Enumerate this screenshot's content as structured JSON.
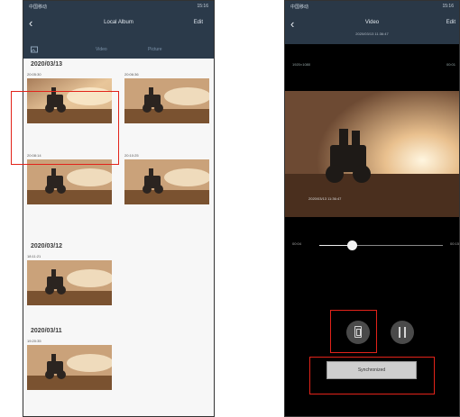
{
  "left_phone": {
    "status_left": "中国移动",
    "status_right": "15:16",
    "nav": {
      "back_icon": "chevron-left-icon",
      "title": "Local Album",
      "edit": "Edit"
    },
    "tabs": {
      "video": "Video",
      "photo": "Picture"
    },
    "groups": [
      {
        "date": "2020/03/13",
        "items": [
          {
            "time": "20:05:30"
          },
          {
            "time": "20:06:36"
          },
          {
            "time": "20:08:14"
          },
          {
            "time": "20:10:25"
          }
        ]
      },
      {
        "date": "2020/03/12",
        "items": [
          {
            "time": "18:11:21"
          }
        ]
      },
      {
        "date": "2020/03/11",
        "items": [
          {
            "time": "19:20:35"
          }
        ]
      }
    ]
  },
  "right_phone": {
    "status_left": "中国移动",
    "status_right": "15:16",
    "nav": {
      "back_icon": "chevron-left-icon",
      "title": "Video",
      "more": "Edit",
      "subtitle": "2020/03/13 11:36:47"
    },
    "meta_left": "1920×1080",
    "meta_right": "00:01",
    "slider": {
      "start": "00:04",
      "end": "00:15",
      "progress": 0.22
    },
    "save_icon": "phone-save-icon",
    "pause_icon": "pause-icon",
    "sync_label": "Synchronized"
  },
  "colors": {
    "header": "#2b3a4a",
    "highlight": "#e2231a"
  }
}
